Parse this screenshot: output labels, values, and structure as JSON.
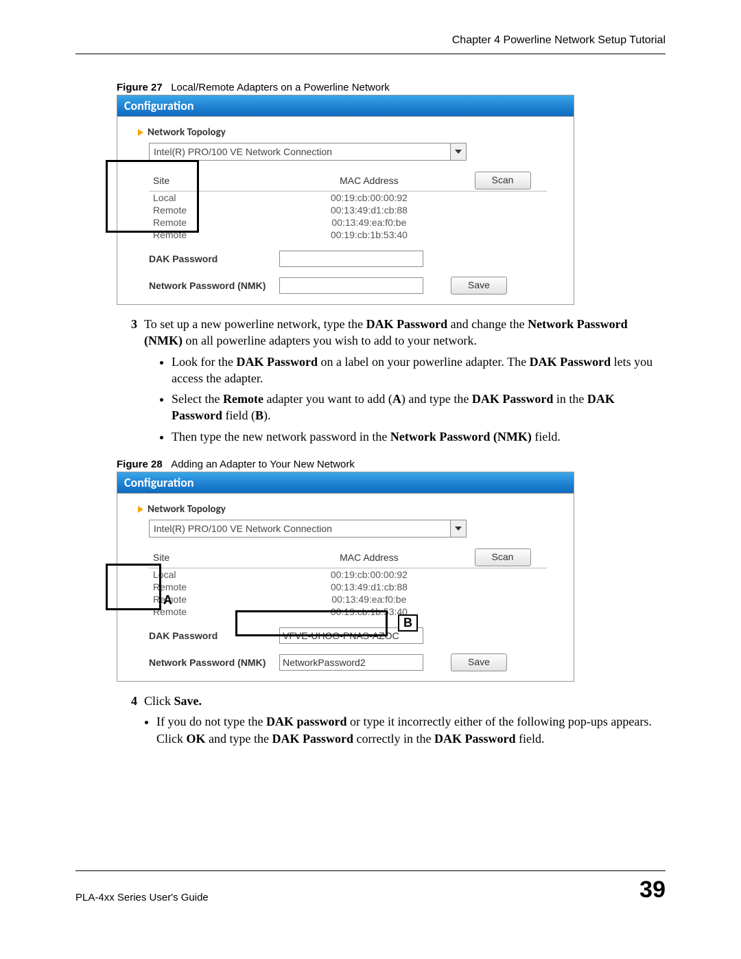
{
  "header": {
    "chapter": "Chapter 4 Powerline Network Setup Tutorial"
  },
  "fig27": {
    "caption_label": "Figure 27",
    "caption_text": "Local/Remote Adapters on a Powerline Network",
    "panel_title": "Configuration",
    "section_title": "Network Topology",
    "dropdown_value": "Intel(R) PRO/100 VE Network Connection",
    "col_site": "Site",
    "col_mac": "MAC Address",
    "scan_btn": "Scan",
    "rows": [
      {
        "site": "Local",
        "mac": "00:19:cb:00:00:92"
      },
      {
        "site": "Remote",
        "mac": "00:13:49:d1:cb:88"
      },
      {
        "site": "Remote",
        "mac": "00:13:49:ea:f0:be"
      },
      {
        "site": "Remote",
        "mac": "00:19:cb:1b:53:40"
      }
    ],
    "dak_label": "DAK Password",
    "dak_value": "",
    "nmk_label": "Network Password (NMK)",
    "nmk_value": "",
    "save_btn": "Save"
  },
  "step3": {
    "num": "3",
    "text_parts": {
      "p1a": "To set up a new powerline network, type the ",
      "p1b": "DAK Password",
      "p1c": " and change the ",
      "p1d": "Network Password (NMK)",
      "p1e": " on all powerline adapters you wish to add to your network."
    },
    "b1": {
      "a": "Look for the ",
      "b": "DAK Password",
      "c": " on a label on your powerline adapter. The ",
      "d": "DAK Password",
      "e": " lets you access the adapter."
    },
    "b2": {
      "a": "Select the ",
      "b": "Remote",
      "c": " adapter you want to add (",
      "d": "A",
      "e": ") and type the ",
      "f": "DAK Password",
      "g": " in the ",
      "h": "DAK Password",
      "i": " field (",
      "j": "B",
      "k": ")."
    },
    "b3": {
      "a": "Then type the new network password in the ",
      "b": "Network Password (NMK)",
      "c": " field."
    }
  },
  "fig28": {
    "caption_label": "Figure 28",
    "caption_text": "Adding an Adapter to Your New Network",
    "panel_title": "Configuration",
    "section_title": "Network Topology",
    "dropdown_value": "Intel(R) PRO/100 VE Network Connection",
    "col_site": "Site",
    "col_mac": "MAC Address",
    "scan_btn": "Scan",
    "rows": [
      {
        "site": "Local",
        "mac": "00:19:cb:00:00:92"
      },
      {
        "site": "Remote",
        "mac": "00:13:49:d1:cb:88"
      },
      {
        "site": "Remote",
        "mac": "00:13:49:ea:f0:be"
      },
      {
        "site": "Remote",
        "mac": "00:19:cb:1b:53:40"
      }
    ],
    "dak_label": "DAK Password",
    "dak_value": "VFVE-UHOO-PNAS-AZOC",
    "nmk_label": "Network Password (NMK)",
    "nmk_value": "NetworkPassword2",
    "save_btn": "Save",
    "marker_a": "A",
    "marker_b": "B"
  },
  "step4": {
    "num": "4",
    "text_a": "Click ",
    "text_b": "Save.",
    "bullet": {
      "a": "If you do not type the ",
      "b": "DAK password",
      "c": " or type it incorrectly either of the following pop-ups appears. Click ",
      "d": "OK",
      "e": " and type the ",
      "f": "DAK Password",
      "g": " correctly in the ",
      "h": "DAK Password",
      "i": " field."
    }
  },
  "footer": {
    "guide": "PLA-4xx Series User's Guide",
    "page": "39"
  }
}
